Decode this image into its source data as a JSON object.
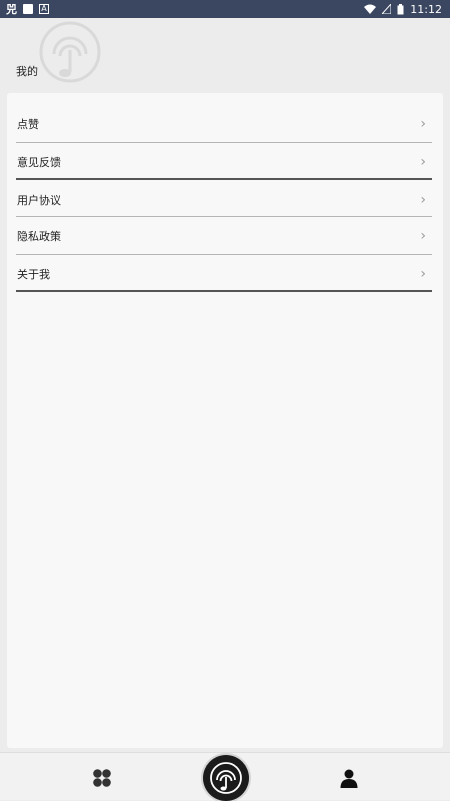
{
  "status_bar": {
    "left_icons": [
      "carrier-icon",
      "image-icon",
      "font-icon"
    ],
    "right_icons": [
      "wifi-icon",
      "no-signal-icon",
      "battery-icon"
    ],
    "time": "11:12"
  },
  "header": {
    "title": "我的",
    "logo_icon": "music-fingerprint-icon"
  },
  "menu": {
    "items": [
      {
        "label": "点赞",
        "icon": "chevron-right-icon"
      },
      {
        "label": "意见反馈",
        "icon": "chevron-right-icon"
      },
      {
        "label": "用户协议",
        "icon": "chevron-right-icon"
      },
      {
        "label": "隐私政策",
        "icon": "chevron-right-icon"
      },
      {
        "label": "关于我",
        "icon": "chevron-right-icon"
      }
    ]
  },
  "bottom_nav": {
    "items": [
      {
        "name": "home",
        "icon": "clover-grid-icon"
      },
      {
        "name": "player",
        "icon": "music-fingerprint-icon"
      },
      {
        "name": "profile",
        "icon": "person-icon"
      }
    ]
  },
  "colors": {
    "status_bar": "#3b4660",
    "background": "#ececec",
    "card": "#f8f8f8",
    "nav_center": "#1b1b1b"
  }
}
